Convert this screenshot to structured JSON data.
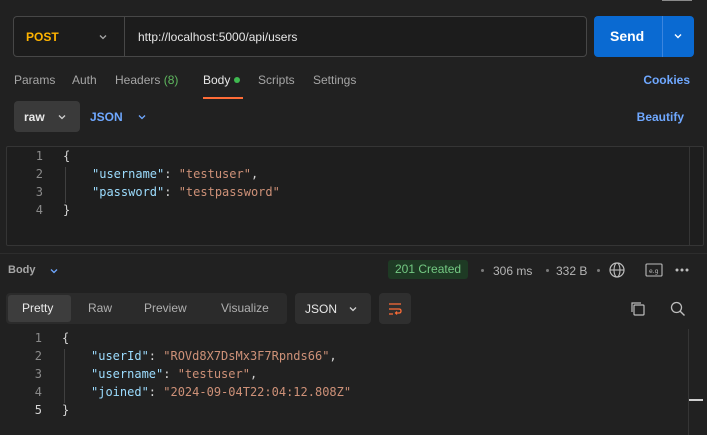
{
  "request": {
    "method": "POST",
    "url": "http://localhost:5000/api/users",
    "send_label": "Send"
  },
  "tabs": {
    "params": "Params",
    "auth": "Auth",
    "headers": "Headers",
    "headers_count": "(8)",
    "body": "Body",
    "scripts": "Scripts",
    "settings": "Settings",
    "cookies": "Cookies"
  },
  "body_controls": {
    "mode": "raw",
    "language": "JSON",
    "beautify": "Beautify"
  },
  "request_body": {
    "line_numbers": [
      "1",
      "2",
      "3",
      "4"
    ],
    "open": "{",
    "close": "}",
    "lines": [
      {
        "key": "\"username\"",
        "value": "\"testuser\"",
        "trail": ","
      },
      {
        "key": "\"password\"",
        "value": "\"testpassword\"",
        "trail": ""
      }
    ]
  },
  "response": {
    "section_label": "Body",
    "status": "201 Created",
    "time": "306 ms",
    "size": "332 B",
    "tabs": [
      "Pretty",
      "Raw",
      "Preview",
      "Visualize"
    ],
    "active_tab": "Pretty",
    "format": "JSON",
    "line_numbers": [
      "1",
      "2",
      "3",
      "4",
      "5"
    ],
    "open": "{",
    "close": "}",
    "lines": [
      {
        "key": "\"userId\"",
        "value": "\"ROVd8X7DsMx3F7Rpnds66\"",
        "trail": ","
      },
      {
        "key": "\"username\"",
        "value": "\"testuser\"",
        "trail": ","
      },
      {
        "key": "\"joined\"",
        "value": "\"2024-09-04T22:04:12.808Z\"",
        "trail": ""
      }
    ]
  },
  "colors": {
    "accent_orange": "#ff6c37",
    "send_blue": "#0a6ad2",
    "method_yellow": "#ffb400",
    "status_green": "#74c983",
    "link_blue": "#6fa8ff"
  },
  "icons": [
    "chevron-down-icon",
    "globe-icon",
    "save-response-icon",
    "more-icon",
    "wrap-lines-icon",
    "copy-icon",
    "search-icon"
  ]
}
